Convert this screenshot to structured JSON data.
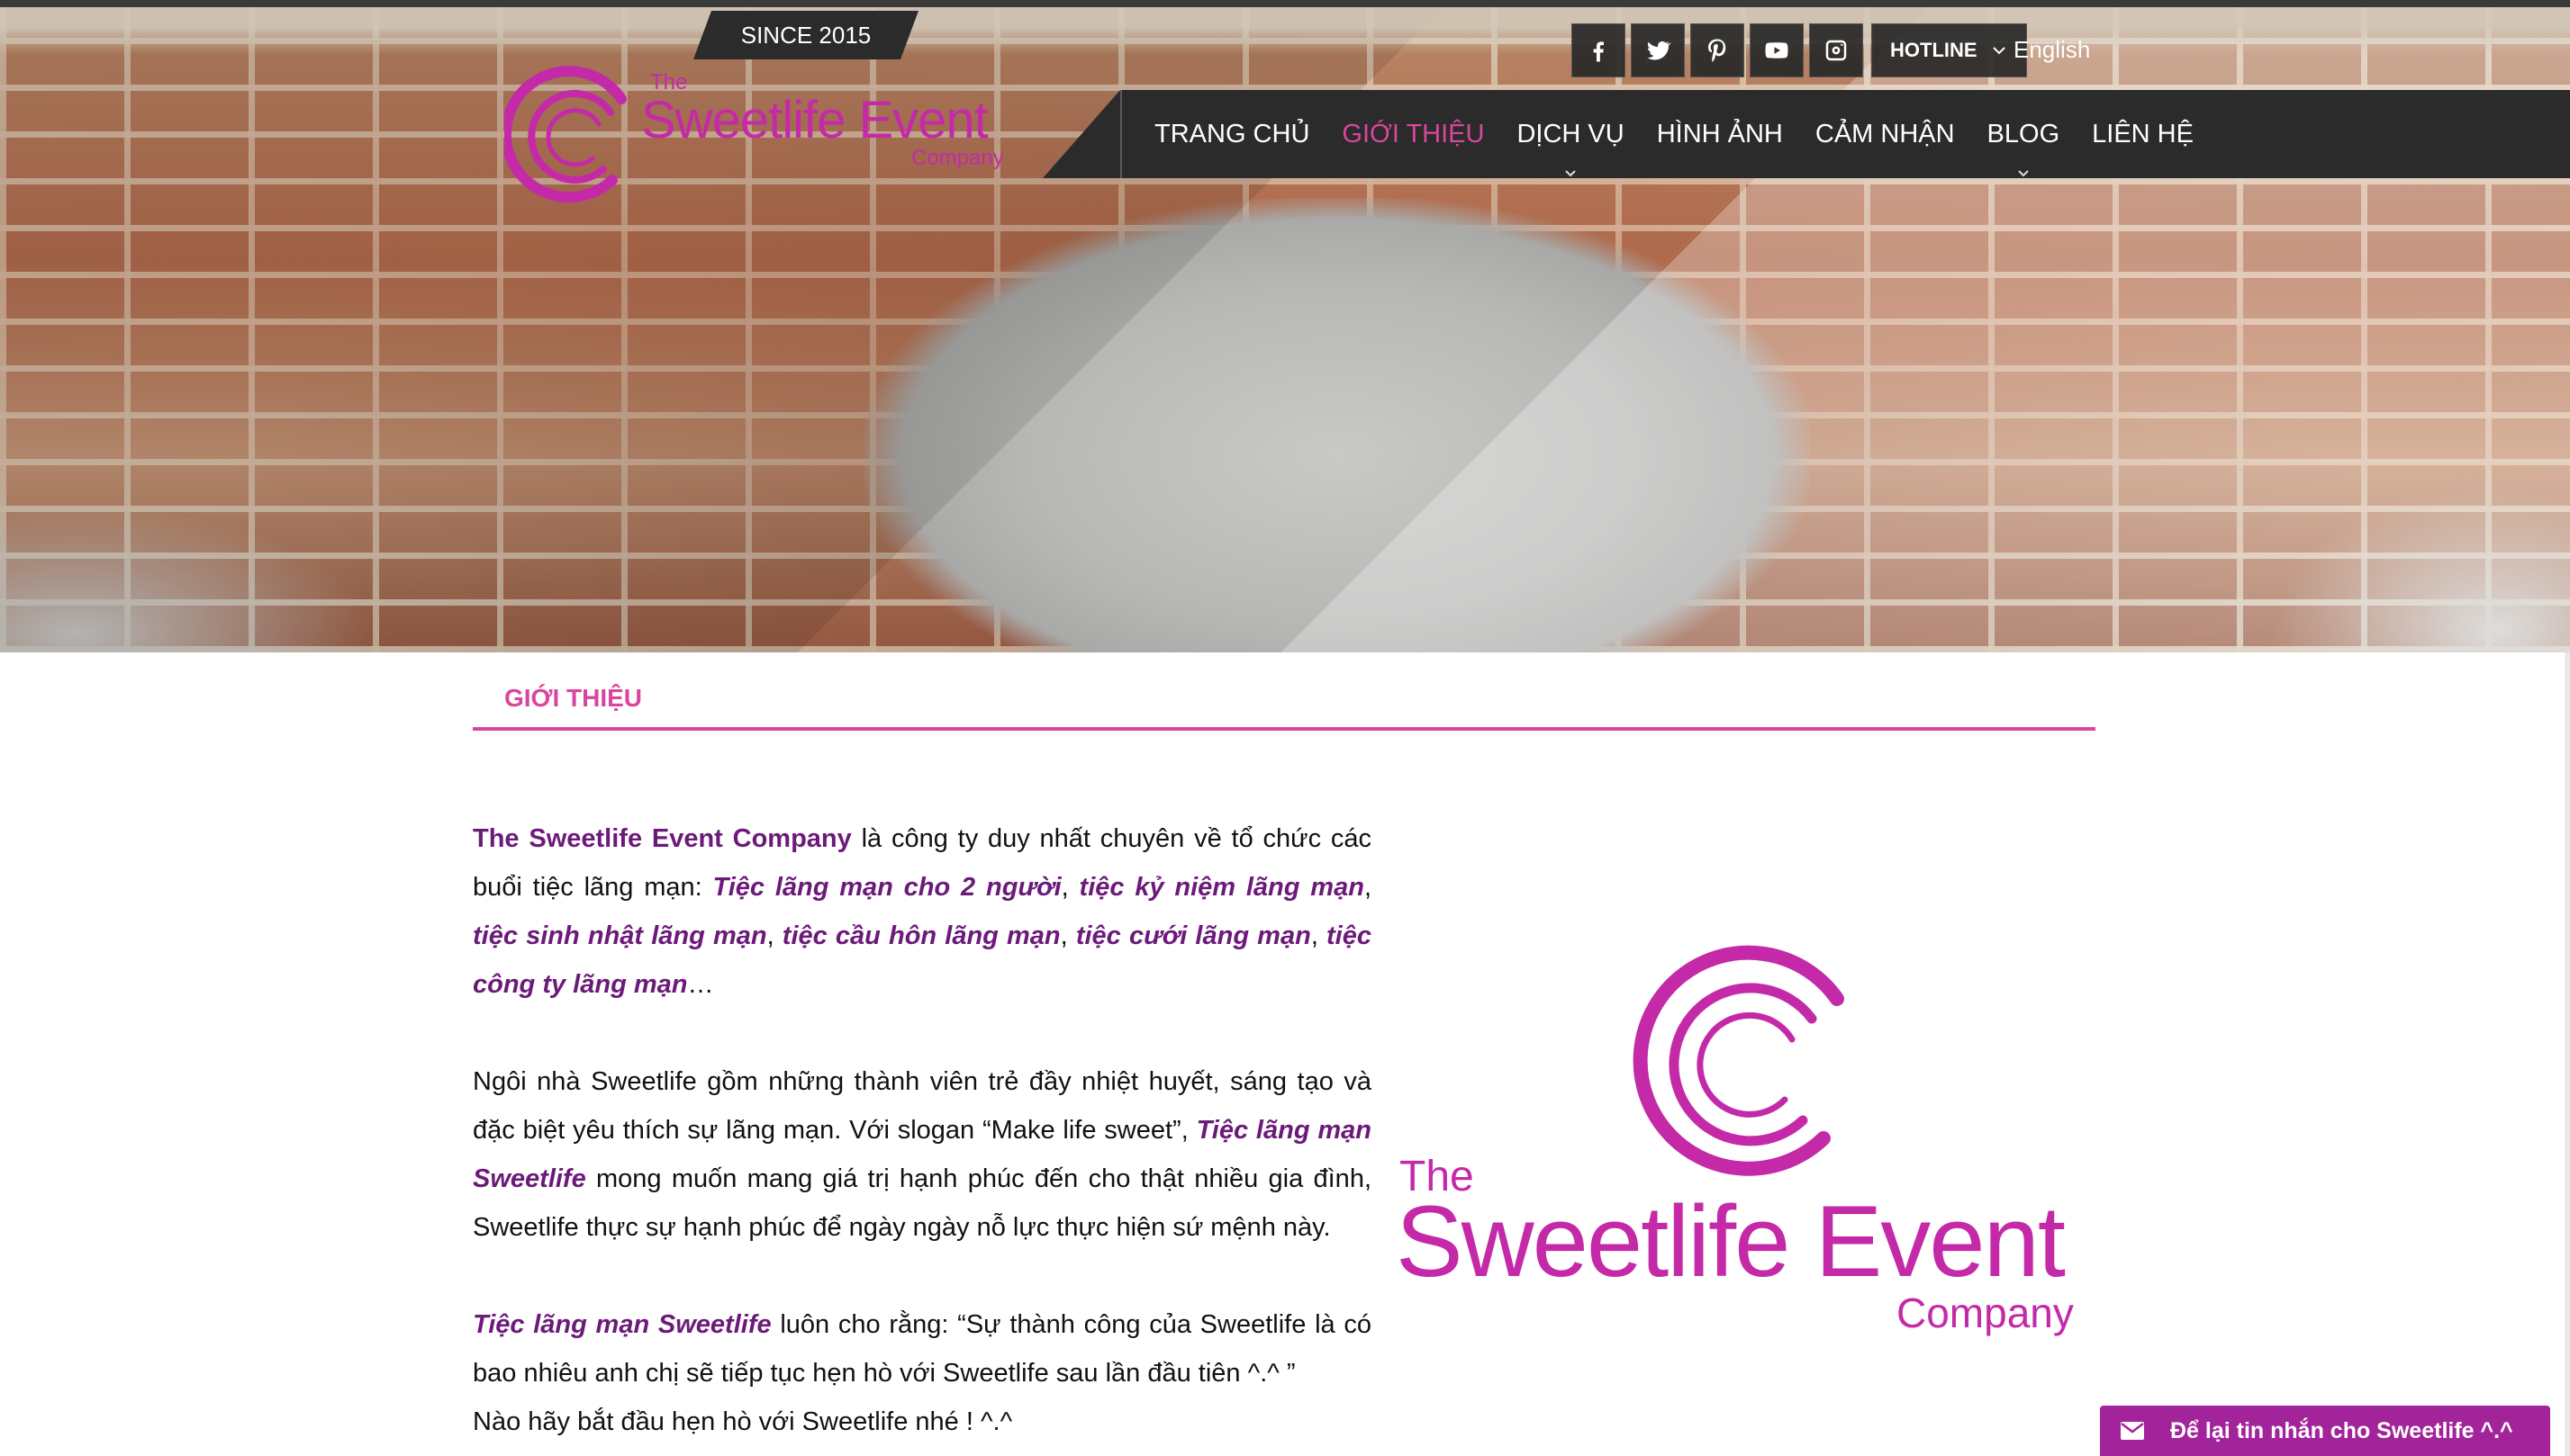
{
  "header": {
    "since_label": "SINCE 2015",
    "logo": {
      "the": "The",
      "name": "Sweetlife Event",
      "company": "Company"
    },
    "social": [
      {
        "name": "facebook-icon"
      },
      {
        "name": "twitter-icon"
      },
      {
        "name": "pinterest-icon"
      },
      {
        "name": "youtube-icon"
      },
      {
        "name": "instagram-icon"
      }
    ],
    "hotline_label": "HOTLINE",
    "language_label": "English"
  },
  "nav": {
    "items": [
      {
        "label": "TRANG CHỦ"
      },
      {
        "label": "GIỚI THIỆU",
        "active": true
      },
      {
        "label": "DỊCH VỤ",
        "has_dropdown": true
      },
      {
        "label": "HÌNH ẢNH"
      },
      {
        "label": "CẢM NHẬN"
      },
      {
        "label": "BLOG",
        "has_dropdown": true
      },
      {
        "label": "LIÊN HỆ"
      }
    ]
  },
  "page": {
    "section_title": "GIỚI THIỆU",
    "p1": {
      "company": "The Sweetlife Event Company",
      "text1": " là công ty duy nhất chuyên về tổ chức các buổi tiệc lãng mạn: ",
      "link1": "Tiệc lãng mạn cho 2 người",
      "sep1": ", ",
      "link2": "tiệc kỷ niệm lãng mạn",
      "sep2": ", ",
      "link3": "tiệc sinh nhật lãng mạn",
      "sep3": ", ",
      "link4": "tiệc cầu hôn lãng mạn",
      "sep4": ", ",
      "link5": "tiệc cưới lãng mạn",
      "sep5": ", ",
      "link6": "tiệc công ty lãng mạn",
      "end": "…"
    },
    "p2": {
      "text1": "Ngôi nhà Sweetlife gồm những thành viên trẻ đầy nhiệt huyết, sáng tạo và đặc biệt yêu thích sự lãng mạn. Với slogan “Make life sweet”, ",
      "link": "Tiệc lãng mạn Sweetlife",
      "text2": " mong muốn mang giá trị hạnh phúc đến cho thật nhiều gia đình, Sweetlife thực sự hạnh phúc để ngày ngày nỗ lực thực hiện sứ mệnh này."
    },
    "p3": {
      "link": "Tiệc lãng mạn Sweetlife",
      "text1": " luôn cho rằng: “Sự thành công của Sweetlife là có bao nhiêu  anh chị sẽ tiếp tục hẹn hò với Sweetlife sau lần đầu tiên ^.^ ”"
    },
    "p4": "Nào hãy bắt đầu hẹn hò với Sweetlife nhé ! ^.^",
    "big_logo": {
      "the": "The",
      "name": "Sweetlife Event",
      "company": "Company"
    }
  },
  "chat": {
    "label": "Để lại tin nhắn cho Sweetlife ^.^"
  },
  "colors": {
    "brand_magenta": "#c42aa8",
    "accent_pink": "#d9469e",
    "link_purple": "#6c1a7a",
    "nav_dark": "#2b2b2b",
    "chat_bg": "#a3239b"
  }
}
